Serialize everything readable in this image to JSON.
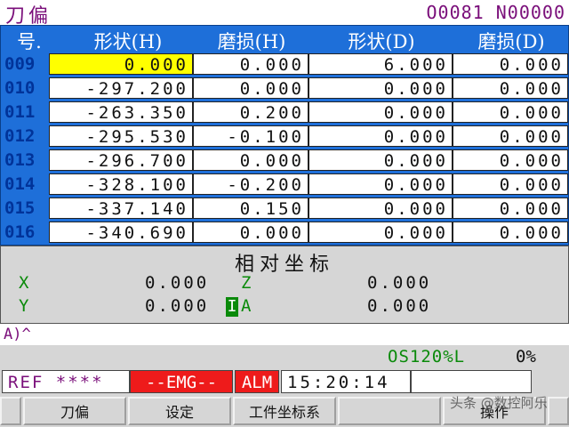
{
  "title": {
    "left": "刀偏",
    "right": "O0081 N00000"
  },
  "table": {
    "headers": [
      "号.",
      "形状(H)",
      "磨损(H)",
      "形状(D)",
      "磨损(D)"
    ],
    "rows": [
      {
        "no": "009",
        "sh": "0.000",
        "wh": "0.000",
        "sd": "6.000",
        "wd": "0.000"
      },
      {
        "no": "010",
        "sh": "-297.200",
        "wh": "0.000",
        "sd": "0.000",
        "wd": "0.000"
      },
      {
        "no": "011",
        "sh": "-263.350",
        "wh": "0.200",
        "sd": "0.000",
        "wd": "0.000"
      },
      {
        "no": "012",
        "sh": "-295.530",
        "wh": "-0.100",
        "sd": "0.000",
        "wd": "0.000"
      },
      {
        "no": "013",
        "sh": "-296.700",
        "wh": "0.000",
        "sd": "0.000",
        "wd": "0.000"
      },
      {
        "no": "014",
        "sh": "-328.100",
        "wh": "-0.200",
        "sd": "0.000",
        "wd": "0.000"
      },
      {
        "no": "015",
        "sh": "-337.140",
        "wh": "0.150",
        "sd": "0.000",
        "wd": "0.000"
      },
      {
        "no": "016",
        "sh": "-340.690",
        "wh": "0.000",
        "sd": "0.000",
        "wd": "0.000"
      }
    ]
  },
  "relative": {
    "title": "相对坐标",
    "x_label": "X",
    "x_value": "0.000",
    "y_label": "Y",
    "y_value": "0.000",
    "z_label": "Z",
    "z_value": "0.000",
    "a_label": "A",
    "a_value": "0.000",
    "cursor": "I"
  },
  "input_line": "A)^",
  "status": {
    "override": "OS120%L",
    "percent": "0%",
    "ref": "REF ****",
    "emg": "--EMG--",
    "alm": "ALM",
    "clock": "15:20:14"
  },
  "softkeys": [
    "刀偏",
    "设定",
    "工件坐标系",
    "",
    "操作"
  ],
  "watermark": "头条 @数控阿乐"
}
